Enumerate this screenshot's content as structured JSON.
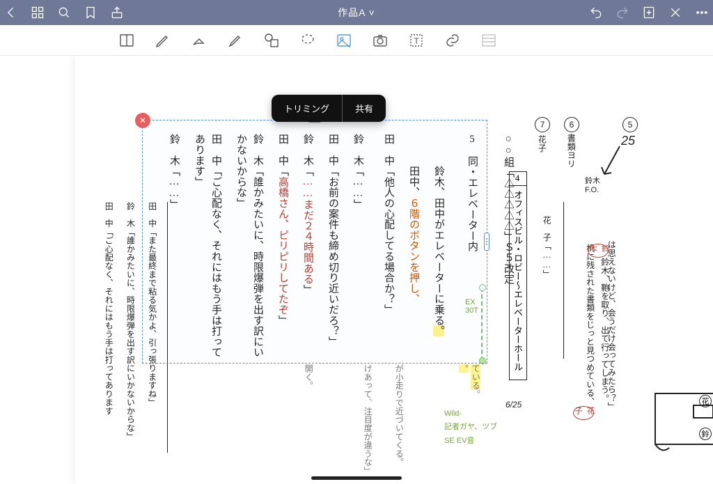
{
  "titlebar": {
    "title": "作品A ˅"
  },
  "popover": {
    "trim": "トリミング",
    "share": "共有"
  },
  "scene4": {
    "num": "4",
    "text": "オフィスビル・ロビー〜エレベーターホール",
    "date": "6/25"
  },
  "right_panel": {
    "circ7": "7",
    "circ6": "6",
    "circ5": "5",
    "hanako7": "花子",
    "book6": "書類ヨリ",
    "num5": "25",
    "suzuki_fo": "鈴木\nF.O.",
    "hanako_line": "花　子「……」",
    "suzuki_ann_name": "鈴木",
    "suzuki_ann": "鈴木、鞄を取り、出て行ってしまう。",
    "desk_ann": "机に残された書類をじっと見つめている、",
    "hanako_small": "花子",
    "omoeru": "は思えないけど、会うだけ会ってみたら？」",
    "room_label_t": "花",
    "room_label_b": "鈴"
  },
  "green": {
    "ex_note": "EX\n30T",
    "wild": "Wild-",
    "gaiya": "記者ガヤ、ツブ",
    "se": "SE EV音"
  },
  "script": {
    "s5_heading": "○○組「△△△△△」Ｓ５改定",
    "s5_num": "5",
    "s5_scene": "同・エレベーター内",
    "line1a": "鈴木、田中がエレベーターに乗る",
    "line1b": "。",
    "line2_name": "田中、",
    "line2_red": "６階のボタンを押し、",
    "l_tanaka1": "田　中「他人の心配してる場合か？」",
    "l_suzuki1": "鈴　木「……」",
    "l_tanaka2": "田　中「お前の案件も締め切り近いだろ？」",
    "l_suzuki2": "鈴　木「",
    "l_suzuki2_red": "……まだ２４時間ある",
    "l_suzuki2_end": "」",
    "l_tanaka3": "田　中「",
    "l_tanaka3_red": "高橋さん、ピリピリしてたぞ",
    "l_tanaka3_end": "」",
    "l_suzuki3": "鈴　木「誰かみたいに、時限爆弾を出す訳にいかないからな」",
    "l_tanaka4": "田　中「ご心配なく、それにはもう手は打ってあります」",
    "l_suzuki4": "鈴　木「……」"
  },
  "leftdoc": {
    "l1": "田　中「また最終まで粘る気かよ、引っ張りますね」",
    "l2": "鈴　木「誰かみたいに、時限爆弾を出す訳にいかないからな」",
    "l3": "田　中「ご心配なく、それにはもう手は打ってあります"
  },
  "below_sel": {
    "a": "が小走りで近づいてくる。",
    "b": "けあって、注目度が違うな」",
    "c": "開く。",
    "d_hl": "ている",
    "d_end": "。",
    "e_hl": "。"
  }
}
